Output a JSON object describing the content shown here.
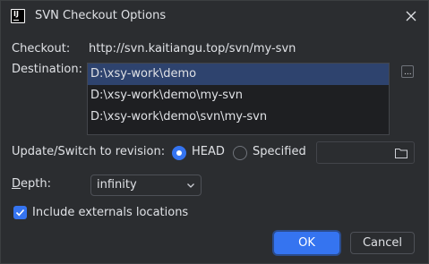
{
  "window": {
    "title": "SVN Checkout Options",
    "icon": "intellij-app-icon",
    "icon_text": "IJ"
  },
  "checkout": {
    "label": "Checkout:",
    "url": "http://svn.kaitiangu.top/svn/my-svn"
  },
  "destination": {
    "label": "Destination:",
    "items": [
      "D:\\xsy-work\\demo",
      "D:\\xsy-work\\demo\\my-svn",
      "D:\\xsy-work\\demo\\svn\\my-svn"
    ],
    "selected_index": 0,
    "browse_label": "..."
  },
  "revision": {
    "label": "Update/Switch to revision:",
    "options": [
      "HEAD",
      "Specified"
    ],
    "selected": "HEAD",
    "specified_value": ""
  },
  "depth": {
    "label_mnemonic": "D",
    "label_rest": "epth:",
    "selected": "infinity"
  },
  "externals": {
    "label": "Include externals locations",
    "checked": true
  },
  "buttons": {
    "ok": "OK",
    "cancel": "Cancel"
  },
  "colors": {
    "background": "#2b2d30",
    "accent": "#3574f0",
    "selection": "#2e436e",
    "text": "#dfe1e5"
  }
}
